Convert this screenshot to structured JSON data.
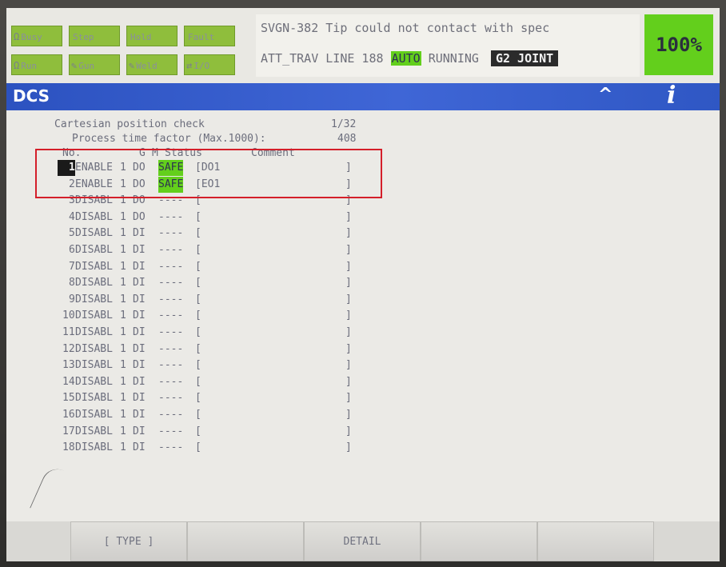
{
  "indicators": {
    "row1": [
      {
        "icon": "Ω",
        "label": "Busy"
      },
      {
        "icon": "",
        "label": "Step"
      },
      {
        "icon": "",
        "label": "Hold"
      },
      {
        "icon": "",
        "label": "Fault"
      }
    ],
    "row2": [
      {
        "icon": "Ω",
        "label": "Run"
      },
      {
        "icon": "✎",
        "label": "Gun"
      },
      {
        "icon": "✎",
        "label": "Weld"
      },
      {
        "icon": "⇄",
        "label": "I/O"
      }
    ]
  },
  "message": {
    "line1": "SVGN-382 Tip could not contact with spec",
    "line2_prefix": "ATT_TRAV LINE 188",
    "auto": "AUTO",
    "running": "RUNNING",
    "mode": "G2 JOINT"
  },
  "override": "100%",
  "title": "DCS",
  "title_icons": {
    "up": "^",
    "info": "i"
  },
  "screen": {
    "heading": "Cartesian position check",
    "page": "1/32",
    "process_label": "Process time factor (Max.1000):",
    "process_value": "408",
    "columns": {
      "no": "No.",
      "g": "G",
      "m": "M",
      "status": "Status",
      "comment": "Comment"
    },
    "rows": [
      {
        "no": "1",
        "state": "ENABLE",
        "g": "1",
        "m": "DO",
        "status": "SAFE",
        "comment": "[DO1"
      },
      {
        "no": "2",
        "state": "ENABLE",
        "g": "1",
        "m": "DO",
        "status": "SAFE",
        "comment": "[EO1"
      },
      {
        "no": "3",
        "state": "DISABL",
        "g": "1",
        "m": "DO",
        "status": "----",
        "comment": "["
      },
      {
        "no": "4",
        "state": "DISABL",
        "g": "1",
        "m": "DO",
        "status": "----",
        "comment": "["
      },
      {
        "no": "5",
        "state": "DISABL",
        "g": "1",
        "m": "DI",
        "status": "----",
        "comment": "["
      },
      {
        "no": "6",
        "state": "DISABL",
        "g": "1",
        "m": "DI",
        "status": "----",
        "comment": "["
      },
      {
        "no": "7",
        "state": "DISABL",
        "g": "1",
        "m": "DI",
        "status": "----",
        "comment": "["
      },
      {
        "no": "8",
        "state": "DISABL",
        "g": "1",
        "m": "DI",
        "status": "----",
        "comment": "["
      },
      {
        "no": "9",
        "state": "DISABL",
        "g": "1",
        "m": "DI",
        "status": "----",
        "comment": "["
      },
      {
        "no": "10",
        "state": "DISABL",
        "g": "1",
        "m": "DI",
        "status": "----",
        "comment": "["
      },
      {
        "no": "11",
        "state": "DISABL",
        "g": "1",
        "m": "DI",
        "status": "----",
        "comment": "["
      },
      {
        "no": "12",
        "state": "DISABL",
        "g": "1",
        "m": "DI",
        "status": "----",
        "comment": "["
      },
      {
        "no": "13",
        "state": "DISABL",
        "g": "1",
        "m": "DI",
        "status": "----",
        "comment": "["
      },
      {
        "no": "14",
        "state": "DISABL",
        "g": "1",
        "m": "DI",
        "status": "----",
        "comment": "["
      },
      {
        "no": "15",
        "state": "DISABL",
        "g": "1",
        "m": "DI",
        "status": "----",
        "comment": "["
      },
      {
        "no": "16",
        "state": "DISABL",
        "g": "1",
        "m": "DI",
        "status": "----",
        "comment": "["
      },
      {
        "no": "17",
        "state": "DISABL",
        "g": "1",
        "m": "DI",
        "status": "----",
        "comment": "["
      },
      {
        "no": "18",
        "state": "DISABL",
        "g": "1",
        "m": "DI",
        "status": "----",
        "comment": "["
      }
    ],
    "close_bracket": "]"
  },
  "fkeys": [
    "[ TYPE ]",
    "",
    "DETAIL",
    "",
    "",
    ""
  ],
  "colors": {
    "accent_green": "#63cf1c",
    "title_blue": "#2c52c0",
    "highlight_red": "#d41f2a"
  }
}
